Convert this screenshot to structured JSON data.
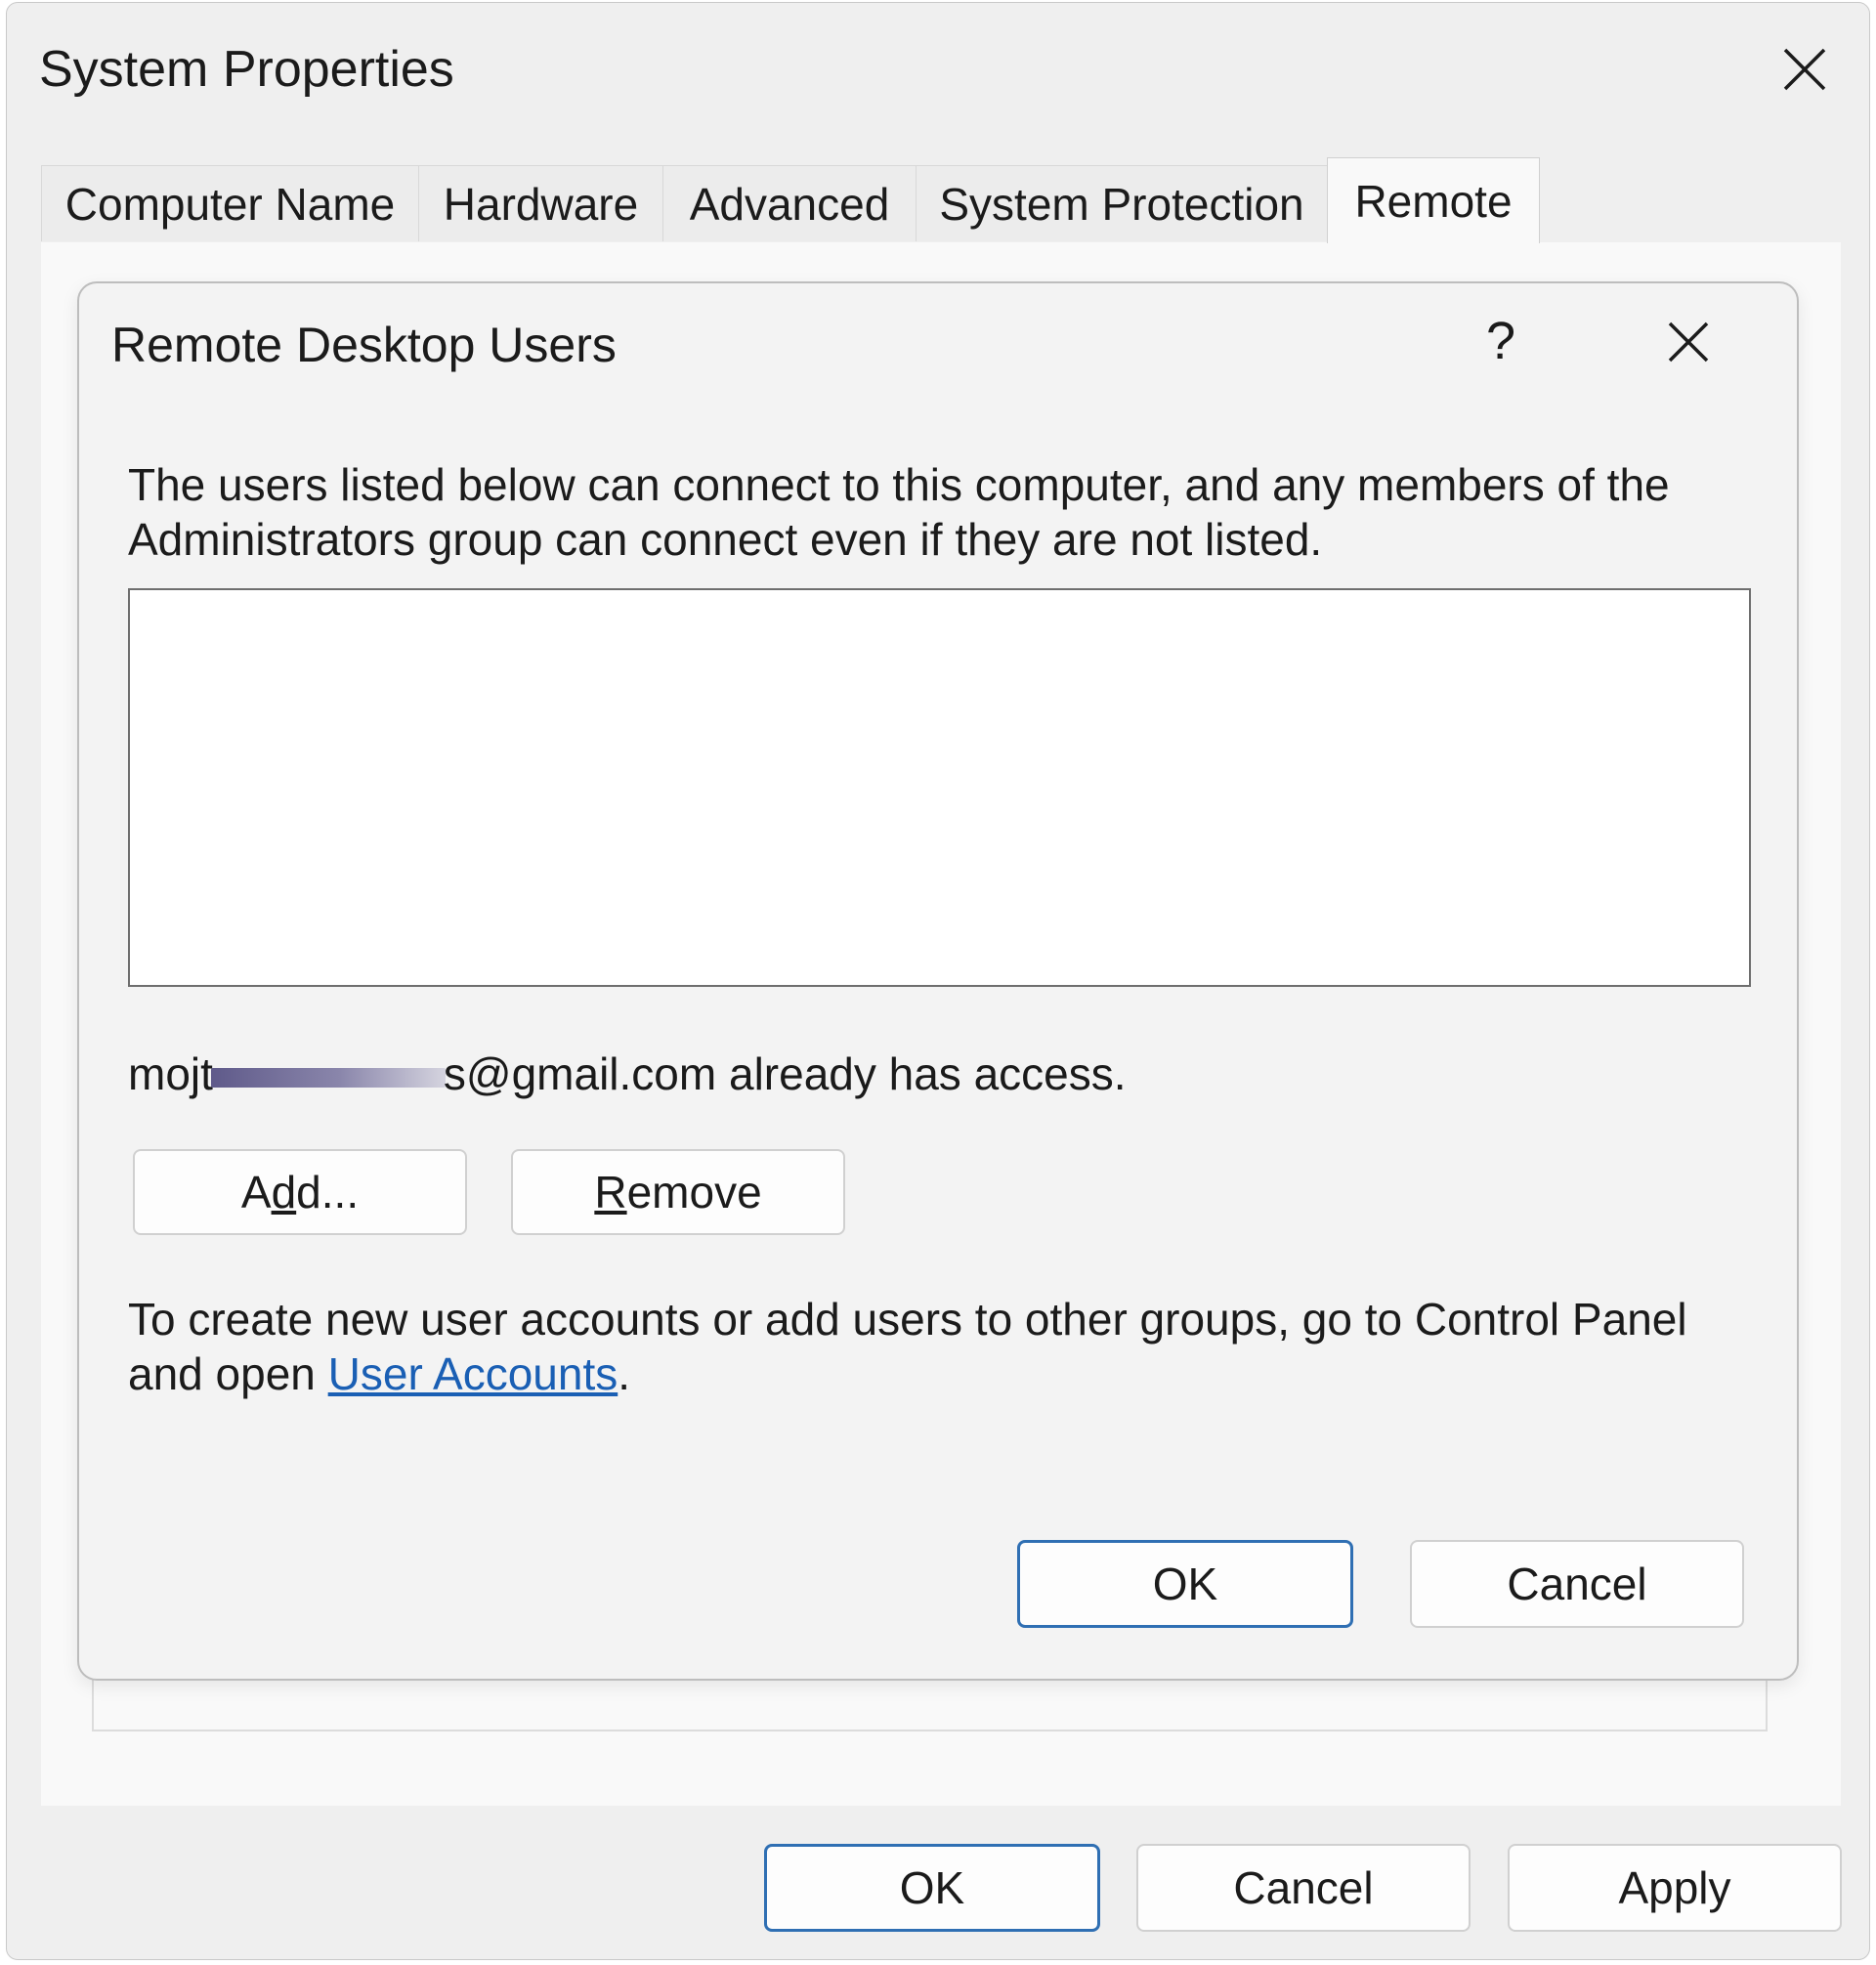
{
  "window": {
    "title": "System Properties"
  },
  "tabs": [
    {
      "label": "Computer Name",
      "active": false
    },
    {
      "label": "Hardware",
      "active": false
    },
    {
      "label": "Advanced",
      "active": false
    },
    {
      "label": "System Protection",
      "active": false
    },
    {
      "label": "Remote",
      "active": true
    }
  ],
  "dialog": {
    "title": "Remote Desktop Users",
    "help_label": "?",
    "description_line1": "The users listed below can connect to this computer, and any members of the",
    "description_line2": "Administrators group can connect even if they are not listed.",
    "users": [],
    "access_prefix": "mojt",
    "access_suffix": "s@gmail.com already has access.",
    "add_button": {
      "prefix": "A",
      "mnemonic": "d",
      "suffix": "d..."
    },
    "remove_button": {
      "mnemonic": "R",
      "suffix": "emove"
    },
    "footer_line1": "To create new user accounts or add users to other groups, go to Control Panel",
    "footer_line2_prefix": "and open ",
    "footer_link": "User Accounts",
    "footer_line2_suffix": ".",
    "ok_label": "OK",
    "cancel_label": "Cancel"
  },
  "footer": {
    "ok_label": "OK",
    "cancel_label": "Cancel",
    "apply_label": "Apply"
  },
  "colors": {
    "primary_button_border": "#2f6fb3",
    "link": "#1a5fb4",
    "window_bg": "#efefef"
  },
  "icons": {
    "window_close": "close-icon",
    "dialog_close": "close-icon"
  }
}
